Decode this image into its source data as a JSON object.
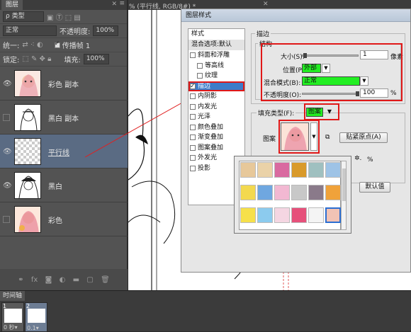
{
  "layers_panel": {
    "tab": "图层",
    "close": "✕",
    "menu": "≡",
    "kind_label": "ρ 类型",
    "blend_mode": "正常",
    "opacity_label": "不透明度:",
    "opacity_value": "100%",
    "unify_label": "统一:",
    "propagate_label": "传播帧 1",
    "lock_label": "锁定:",
    "fill_label": "填充:",
    "fill_value": "100%",
    "layers": [
      {
        "name": "彩色 副本",
        "visible": true
      },
      {
        "name": "黑白 副本",
        "visible": false
      },
      {
        "name": "平行线",
        "visible": true
      },
      {
        "name": "黑白",
        "visible": true
      },
      {
        "name": "彩色",
        "visible": false
      }
    ],
    "footer_icons": [
      "link-icon",
      "fx-icon",
      "mask-icon",
      "adjustment-icon",
      "folder-icon",
      "new-layer-icon",
      "trash-icon"
    ]
  },
  "document": {
    "title": "% (平行线, RGB/8#) *",
    "close": "✕"
  },
  "dialog": {
    "title": "图层样式",
    "styles_header": "样式",
    "blend_options": "混合选项:默认",
    "styles": [
      {
        "label": "斜面和浮雕",
        "checked": false,
        "indent": false
      },
      {
        "label": "等高线",
        "checked": false,
        "indent": true
      },
      {
        "label": "纹理",
        "checked": false,
        "indent": true
      },
      {
        "label": "描边",
        "checked": true,
        "indent": false,
        "selected": true
      },
      {
        "label": "内阴影",
        "checked": false,
        "indent": false
      },
      {
        "label": "内发光",
        "checked": false,
        "indent": false
      },
      {
        "label": "光泽",
        "checked": false,
        "indent": false
      },
      {
        "label": "颜色叠加",
        "checked": false,
        "indent": false
      },
      {
        "label": "渐变叠加",
        "checked": false,
        "indent": false
      },
      {
        "label": "图案叠加",
        "checked": false,
        "indent": false
      },
      {
        "label": "外发光",
        "checked": false,
        "indent": false
      },
      {
        "label": "投影",
        "checked": false,
        "indent": false
      }
    ],
    "stroke_group": "描边",
    "structure_group": "结构",
    "size_label": "大小(S):",
    "size_value": "1",
    "size_unit": "像素",
    "size_level": 0.01,
    "position_label": "位置(P):",
    "position_value": "外部",
    "blend_label": "混合模式(B):",
    "blend_value": "正常",
    "opacity_label": "不透明度(O):",
    "opacity_value": "100",
    "opacity_unit": "%",
    "opacity_level": 1.0,
    "fill_type_label": "填充类型(F):",
    "fill_type_value": "图案",
    "pattern_label": "图案",
    "snap_button": "贴紧原点(A)",
    "scale_unit": "%",
    "default_button": "默认值",
    "gear": "✲."
  },
  "pattern_swatches": [
    {
      "name": "beige-pattern",
      "color": "#e7c89a"
    },
    {
      "name": "beige-pattern-2",
      "color": "#ead2a8"
    },
    {
      "name": "floral-pattern",
      "color": "#d96aa0"
    },
    {
      "name": "sunburst-pattern",
      "color": "#d99a2a"
    },
    {
      "name": "teal-pattern",
      "color": "#9fc0c0"
    },
    {
      "name": "blue-wash-pattern",
      "color": "#9ec3e6"
    },
    {
      "name": "yellow-pattern",
      "color": "#f3d94f"
    },
    {
      "name": "blue-pattern",
      "color": "#6fa7e0"
    },
    {
      "name": "pink-pattern",
      "color": "#f2b8d2"
    },
    {
      "name": "grey-pattern",
      "color": "#c8c8c8"
    },
    {
      "name": "damask-pattern",
      "color": "#8a7a8a"
    },
    {
      "name": "orange-pattern",
      "color": "#f0a23a"
    },
    {
      "name": "yellow-dots-pattern",
      "color": "#f6e04a"
    },
    {
      "name": "sky-pattern",
      "color": "#8ccbee"
    },
    {
      "name": "pale-pink-pattern",
      "color": "#f5d6e2"
    },
    {
      "name": "candy-pattern",
      "color": "#e6507a"
    },
    {
      "name": "bw-girl-pattern",
      "color": "#f4f4f4"
    },
    {
      "name": "color-girl-pattern",
      "color": "#f2c3b5"
    }
  ],
  "timeline": {
    "tab": "时间轴",
    "frames": [
      {
        "number": "1",
        "delay": "0 秒▾"
      },
      {
        "number": "2",
        "delay": "0.1▾"
      }
    ]
  }
}
